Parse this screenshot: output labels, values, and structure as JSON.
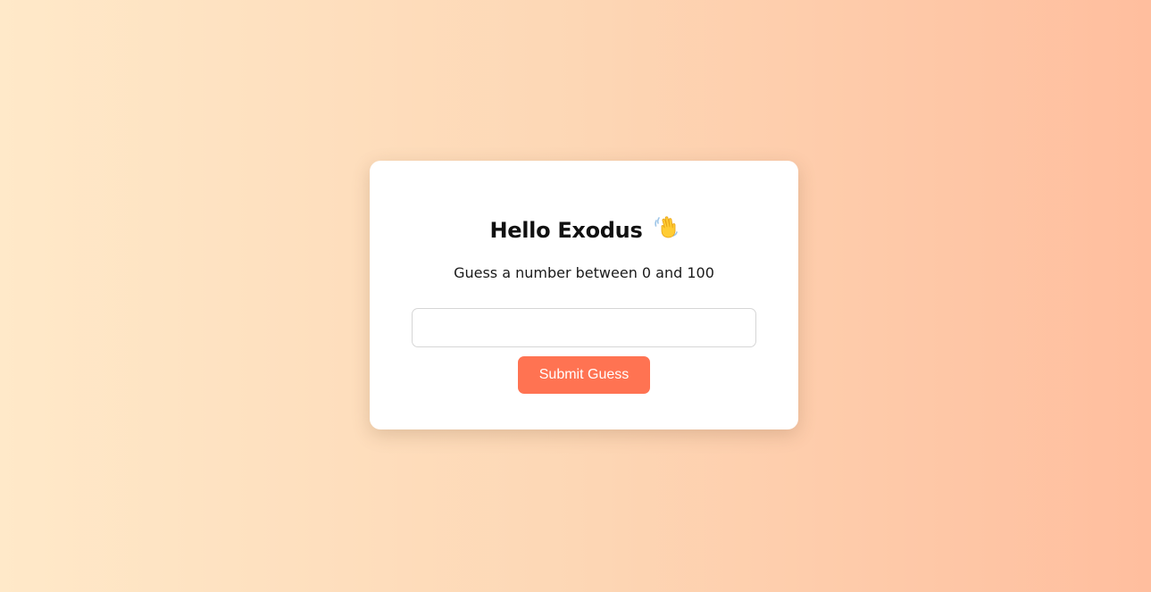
{
  "card": {
    "title": "Hello Exodus",
    "title_icon": "waving-hand-icon",
    "subtitle": "Guess a number between 0 and 100",
    "guess_input": {
      "value": "",
      "placeholder": ""
    },
    "submit_label": "Submit Guess"
  },
  "colors": {
    "background_start": "#ffe9c9",
    "background_end": "#ffbe9e",
    "card": "#ffffff",
    "button": "#ff7352",
    "button_text": "#ffffff"
  }
}
